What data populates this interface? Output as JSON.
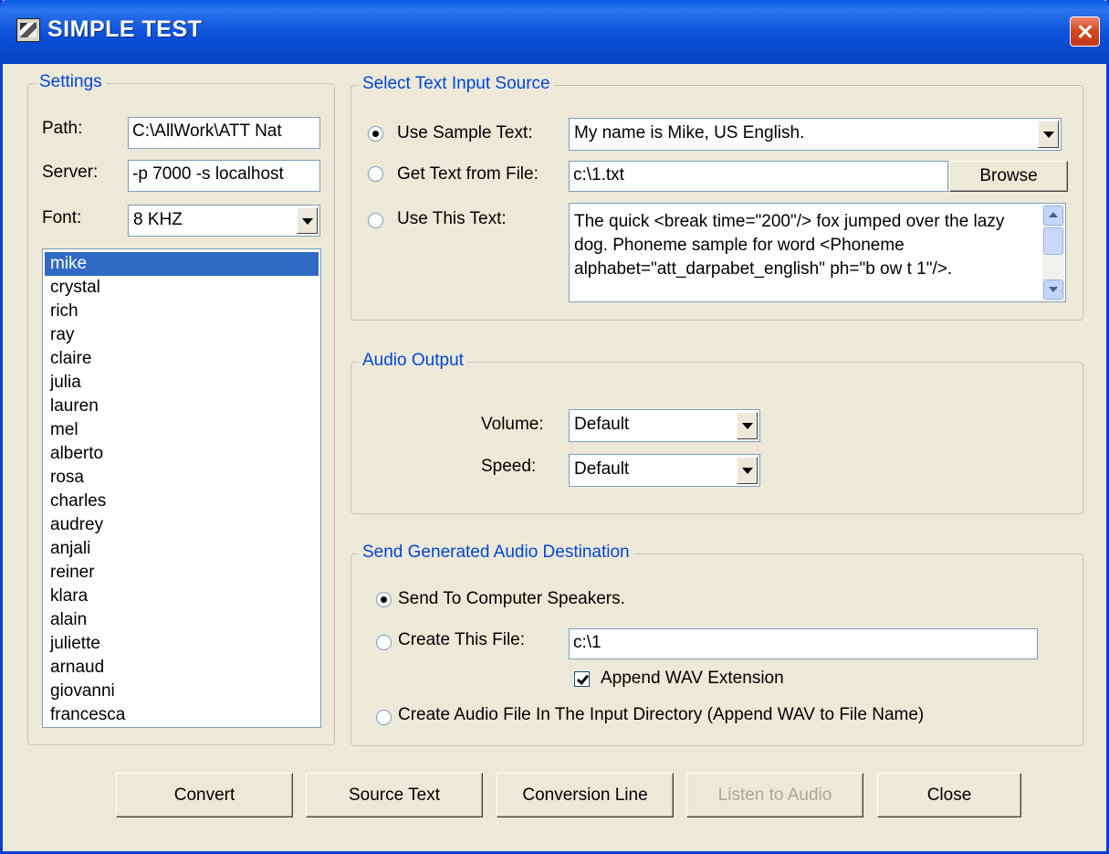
{
  "window": {
    "title": "SIMPLE TEST"
  },
  "settings": {
    "legend": "Settings",
    "path_label": "Path:",
    "path_value": "C:\\AllWork\\ATT Nat",
    "server_label": "Server:",
    "server_value": "-p 7000 -s localhost",
    "font_label": "Font:",
    "font_value": "8 KHZ",
    "voices": [
      "mike",
      "crystal",
      "rich",
      "ray",
      "claire",
      "julia",
      "lauren",
      "mel",
      "alberto",
      "rosa",
      "charles",
      "audrey",
      "anjali",
      "reiner",
      "klara",
      "alain",
      "juliette",
      "arnaud",
      "giovanni",
      "francesca"
    ],
    "selected_voice": "mike"
  },
  "text_source": {
    "legend": "Select Text Input Source",
    "sample_label": "Use Sample Text:",
    "sample_value": "My name is Mike, US English.",
    "file_label": "Get Text from File:",
    "file_value": "c:\\1.txt",
    "browse_label": "Browse",
    "this_text_label": "Use This Text:",
    "this_text_value": "The quick <break time=\"200\"/> fox jumped over the lazy dog. Phoneme sample for word <Phoneme alphabet=\"att_darpabet_english\" ph=\"b ow t 1\"/>.",
    "selected": "sample"
  },
  "audio_output": {
    "legend": "Audio Output",
    "volume_label": "Volume:",
    "volume_value": "Default",
    "speed_label": "Speed:",
    "speed_value": "Default"
  },
  "destination": {
    "legend": "Send Generated Audio Destination",
    "speakers_label": "Send To Computer Speakers.",
    "create_file_label": "Create This File:",
    "create_file_value": "c:\\1",
    "append_wav_label": "Append WAV Extension",
    "append_wav_checked": true,
    "input_dir_label": "Create Audio File In The Input Directory (Append WAV to File Name)",
    "selected": "speakers"
  },
  "buttons": {
    "convert": "Convert",
    "source_text": "Source Text",
    "conversion_line": "Conversion Line",
    "listen": "Listen to Audio",
    "close": "Close"
  }
}
